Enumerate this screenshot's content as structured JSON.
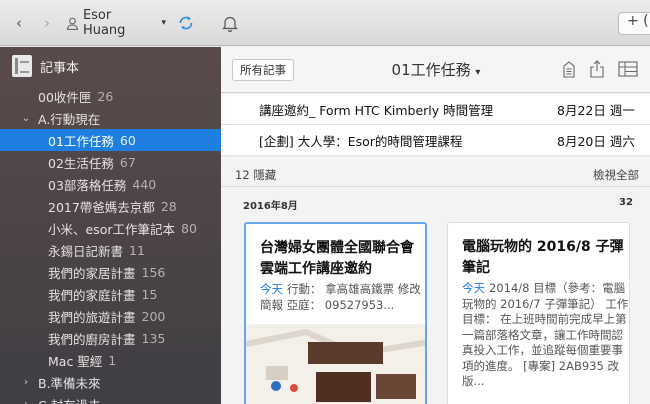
{
  "toolbar": {
    "user_name": "Esor Huang",
    "new_note_label": "+ (",
    "icons": [
      "back-icon",
      "forward-icon",
      "user-icon",
      "sync-icon",
      "bell-icon"
    ]
  },
  "sidebar": {
    "header": "記事本",
    "items": [
      {
        "label": "00收件匣",
        "count": "26",
        "level": 1,
        "arrow": ""
      },
      {
        "label": "A.行動現在",
        "count": "",
        "level": 0,
        "arrow": "⌄"
      },
      {
        "label": "01工作任務",
        "count": "60",
        "level": 2,
        "arrow": "",
        "active": true
      },
      {
        "label": "02生活任務",
        "count": "67",
        "level": 2,
        "arrow": ""
      },
      {
        "label": "03部落格任務",
        "count": "440",
        "level": 2,
        "arrow": ""
      },
      {
        "label": "2017帶爸媽去京都",
        "count": "28",
        "level": 2,
        "arrow": ""
      },
      {
        "label": "小米、esor工作筆記本",
        "count": "80",
        "level": 2,
        "arrow": ""
      },
      {
        "label": "永錫日記新書",
        "count": "11",
        "level": 2,
        "arrow": ""
      },
      {
        "label": "我們的家居計畫",
        "count": "156",
        "level": 2,
        "arrow": ""
      },
      {
        "label": "我們的家庭計畫",
        "count": "15",
        "level": 2,
        "arrow": ""
      },
      {
        "label": "我們的旅遊計畫",
        "count": "200",
        "level": 2,
        "arrow": ""
      },
      {
        "label": "我們的廚房計畫",
        "count": "135",
        "level": 2,
        "arrow": ""
      },
      {
        "label": "Mac 聖經",
        "count": "1",
        "level": 2,
        "arrow": ""
      },
      {
        "label": "B.準備未來",
        "count": "",
        "level": 0,
        "arrow": "›"
      },
      {
        "label": "C.封存過去",
        "count": "",
        "level": 0,
        "arrow": "›"
      }
    ]
  },
  "main": {
    "all_notes_button": "所有記事",
    "notebook_title": "01工作任務",
    "rows": [
      {
        "title": "講座邀約_ Form HTC Kimberly 時間管理",
        "date": "8月22日 週一"
      },
      {
        "title": "[企劃] 大人學：Esor的時間管理課程",
        "date": "8月20日 週六"
      }
    ],
    "hidden_label": "12 隱藏",
    "view_all": "檢視全部",
    "month_label": "2016年8月",
    "month_count": "32",
    "cards": [
      {
        "title": "台灣婦女團體全國聯合會雲端工作講座邀約",
        "today": "今天",
        "body": "行動： 拿高雄高鐵票 修改簡報 亞庭： 09527953..."
      },
      {
        "title": "電腦玩物的 2016/8 子彈筆記",
        "today": "今天",
        "body": "2014/8 目標（參考：電腦玩物的 2016/7 子彈筆記） 工作目標： 在上班時間前完成早上第一篇部落格文章，讓工作時間認真投入工作，並追蹤每個重要事項的進度。 [專案] 2AB935 改版..."
      }
    ]
  }
}
